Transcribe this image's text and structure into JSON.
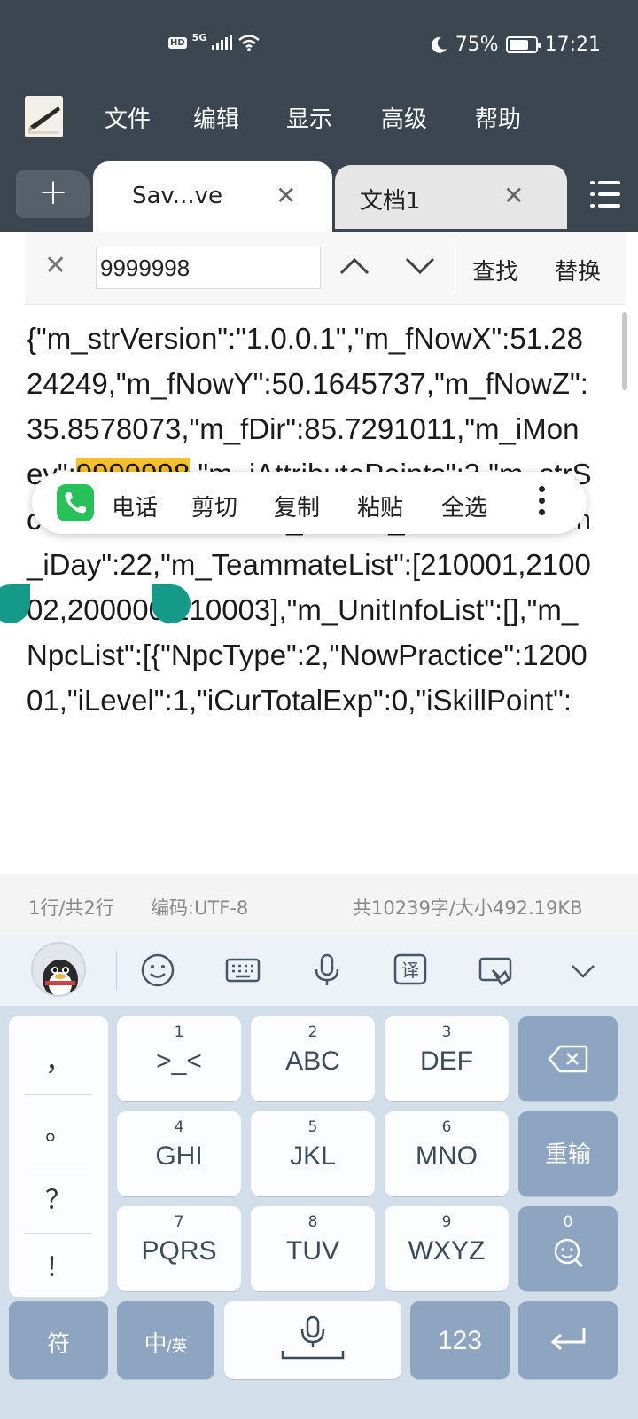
{
  "status_bar": {
    "hd": "HD",
    "network": "5G",
    "battery": "75%",
    "battery_level": 0.75,
    "time": "17:21"
  },
  "menu": {
    "items": [
      "文件",
      "编辑",
      "显示",
      "高级",
      "帮助"
    ]
  },
  "tabs": {
    "new_tab": "+",
    "items": [
      {
        "label": "Sav...ve",
        "active": true
      },
      {
        "label": "文档1",
        "active": false
      }
    ]
  },
  "search": {
    "value": "9999998",
    "find_label": "查找",
    "replace_label": "替换"
  },
  "document": {
    "before_highlight": "{\"m_strVersion\":\"1.0.0.1\",\"m_fNowX\":51.2824249,\"m_fNowY\":50.1645737,\"m_fNowZ\":35.8578073,\"m_fDir\":85.7291011,\"m_iMoney\":",
    "highlight": "9999998",
    "after_highlight": ",\"m_iAttributePoints\":3,\"m_strSceneName\":\"M0046_01\",\"m_iRound\":30,\"m_iDay\":22,\"m_TeammateList\":[210001,210002,200000,210003],\"m_UnitInfoList\":[],\"m_NpcList\":[{\"NpcType\":2,\"NowPractice\":120001,\"iLevel\":1,\"iCurTotalExp\":0,\"iSkillPoint\":"
  },
  "context_menu": {
    "items": [
      "电话",
      "剪切",
      "复制",
      "粘贴",
      "全选"
    ]
  },
  "info_bar": {
    "line_info": "1行/共2行",
    "encoding": "编码:UTF-8",
    "size_info": "共10239字/大小492.19KB"
  },
  "keyboard": {
    "punctuation": [
      "，",
      "。",
      "？",
      "！"
    ],
    "keys": [
      {
        "num": "1",
        "label": ">_<"
      },
      {
        "num": "2",
        "label": "ABC"
      },
      {
        "num": "3",
        "label": "DEF"
      },
      {
        "num": "4",
        "label": "GHI"
      },
      {
        "num": "5",
        "label": "JKL"
      },
      {
        "num": "6",
        "label": "MNO"
      },
      {
        "num": "7",
        "label": "PQRS"
      },
      {
        "num": "8",
        "label": "TUV"
      },
      {
        "num": "9",
        "label": "WXYZ"
      }
    ],
    "retype": "重输",
    "zero": "0",
    "symbols": "符",
    "lang_main": "中",
    "lang_alt": "/英",
    "numbers": "123"
  }
}
